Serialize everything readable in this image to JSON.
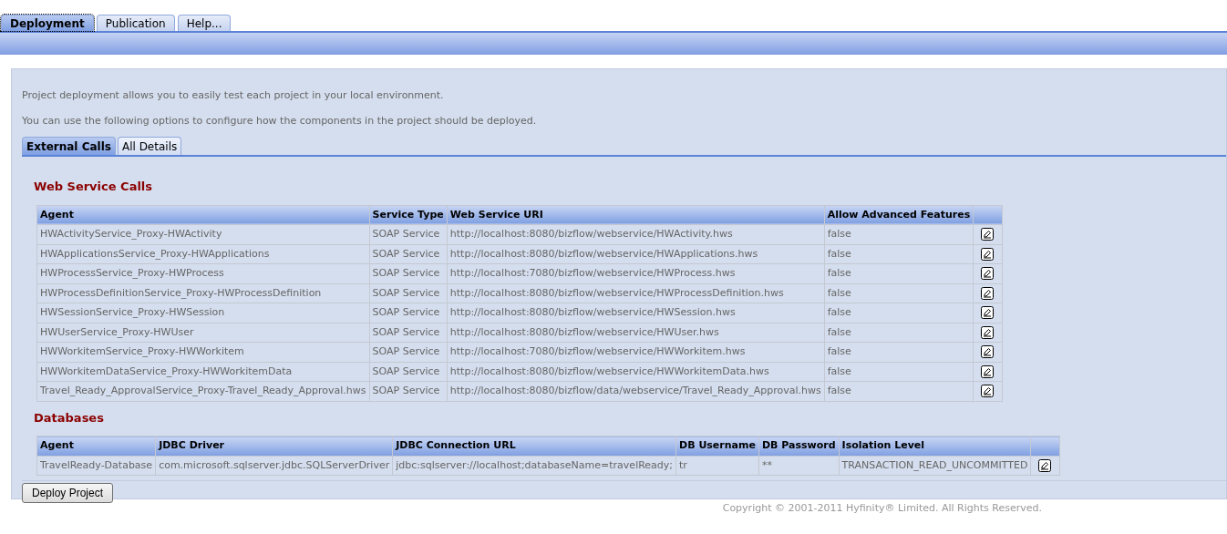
{
  "main_tabs": [
    {
      "label": "Deployment",
      "selected": true
    },
    {
      "label": "Publication",
      "selected": false
    },
    {
      "label": "Help...",
      "selected": false
    }
  ],
  "intro": [
    "Project deployment allows you to easily test each project in your local environment.",
    "You can use the following options to configure how the components in the project should be deployed."
  ],
  "sub_tabs": [
    {
      "label": "External Calls",
      "selected": true
    },
    {
      "label": "All Details",
      "selected": false
    }
  ],
  "web_service_calls": {
    "title": "Web Service Calls",
    "columns": [
      "Agent",
      "Service Type",
      "Web Service URI",
      "Allow Advanced Features"
    ],
    "rows": [
      [
        "HWActivityService_Proxy-HWActivity",
        "SOAP Service",
        "http://localhost:8080/bizflow/webservice/HWActivity.hws",
        "false"
      ],
      [
        "HWApplicationsService_Proxy-HWApplications",
        "SOAP Service",
        "http://localhost:8080/bizflow/webservice/HWApplications.hws",
        "false"
      ],
      [
        "HWProcessService_Proxy-HWProcess",
        "SOAP Service",
        "http://localhost:7080/bizflow/webservice/HWProcess.hws",
        "false"
      ],
      [
        "HWProcessDefinitionService_Proxy-HWProcessDefinition",
        "SOAP Service",
        "http://localhost:8080/bizflow/webservice/HWProcessDefinition.hws",
        "false"
      ],
      [
        "HWSessionService_Proxy-HWSession",
        "SOAP Service",
        "http://localhost:8080/bizflow/webservice/HWSession.hws",
        "false"
      ],
      [
        "HWUserService_Proxy-HWUser",
        "SOAP Service",
        "http://localhost:8080/bizflow/webservice/HWUser.hws",
        "false"
      ],
      [
        "HWWorkitemService_Proxy-HWWorkitem",
        "SOAP Service",
        "http://localhost:7080/bizflow/webservice/HWWorkitem.hws",
        "false"
      ],
      [
        "HWWorkitemDataService_Proxy-HWWorkitemData",
        "SOAP Service",
        "http://localhost:8080/bizflow/webservice/HWWorkitemData.hws",
        "false"
      ],
      [
        "Travel_Ready_ApprovalService_Proxy-Travel_Ready_Approval.hws",
        "SOAP Service",
        "http://localhost:8080/bizflow/data/webservice/Travel_Ready_Approval.hws",
        "false"
      ]
    ]
  },
  "databases": {
    "title": "Databases",
    "columns": [
      "Agent",
      "JDBC Driver",
      "JDBC Connection URL",
      "DB Username",
      "DB Password",
      "Isolation Level"
    ],
    "rows": [
      [
        "TravelReady-Database",
        "com.microsoft.sqlserver.jdbc.SQLServerDriver",
        "jdbc:sqlserver://localhost;databaseName=travelReady;",
        "tr",
        "**",
        "TRANSACTION_READ_UNCOMMITTED"
      ]
    ]
  },
  "deploy_button": "Deploy Project",
  "footer": "Copyright © 2001-2011 Hyfinity® Limited. All Rights Reserved."
}
